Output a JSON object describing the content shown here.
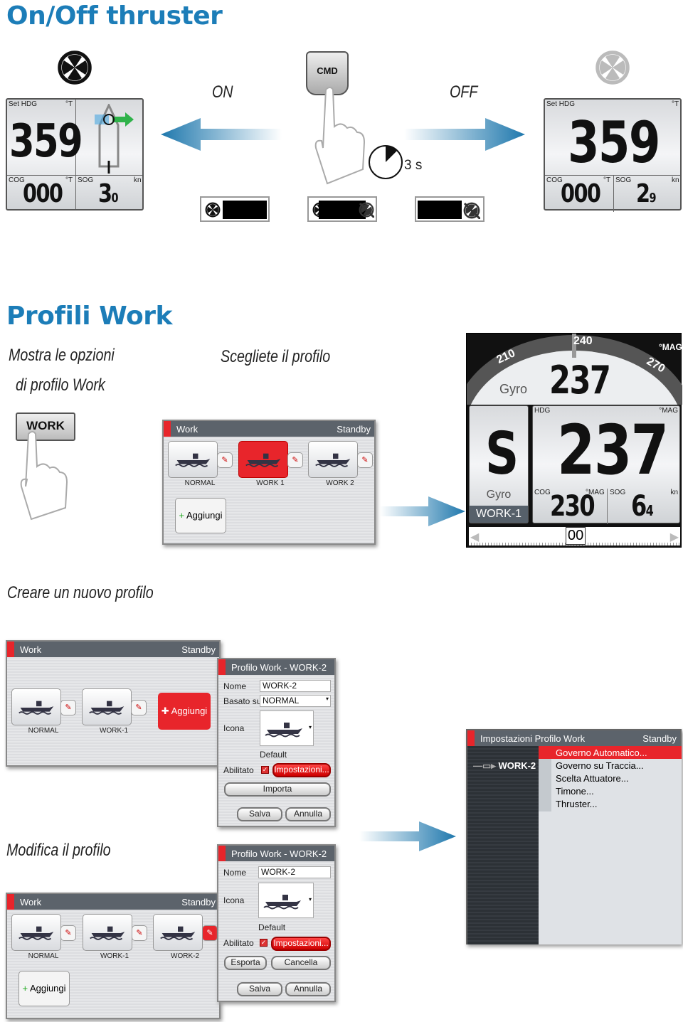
{
  "section1": {
    "title": "On/Off thruster",
    "on_label": "ON",
    "off_label": "OFF",
    "cmd_label": "CMD",
    "timer_label": "3 s",
    "left_display": {
      "set_hdg_label": "Set HDG",
      "hdg_unit": "°T",
      "hdg_value": "359",
      "cog_label": "COG",
      "cog_unit": "°T",
      "cog_value": "000",
      "sog_label": "SOG",
      "sog_unit": "kn",
      "sog_value": "3",
      "sog_decimal": "0"
    },
    "right_display": {
      "set_hdg_label": "Set HDG",
      "hdg_unit": "°T",
      "hdg_value": "359",
      "cog_label": "COG",
      "cog_unit": "°T",
      "cog_value": "000",
      "sog_label": "SOG",
      "sog_unit": "kn",
      "sog_value": "2",
      "sog_decimal": "9"
    }
  },
  "section2": {
    "title": "Profili Work",
    "caption_show_line1": "Mostra le opzioni",
    "caption_show_line2": "di profilo Work",
    "caption_choose": "Scegliete il profilo",
    "work_button": "WORK",
    "work_window": {
      "title": "Work",
      "status": "Standby",
      "tiles": [
        "NORMAL",
        "WORK 1",
        "WORK 2"
      ],
      "selected": "WORK 1",
      "add_button": "Aggiungi"
    },
    "autopilot": {
      "compass_ticks": [
        "210",
        "240",
        "270"
      ],
      "compass_unit": "°MAG",
      "source": "Gyro",
      "heading": "237",
      "mode": "S",
      "mode_source": "Gyro",
      "profile": "WORK-1",
      "hdg_label": "HDG",
      "hdg_unit": "°MAG",
      "hdg_value": "237",
      "cog_label": "COG",
      "cog_unit": "°MAG",
      "cog_value": "230",
      "sog_label": "SOG",
      "sog_unit": "kn",
      "sog_value": "6",
      "sog_decimal": "4",
      "rudder_value": "00"
    }
  },
  "section3": {
    "caption": "Creare un nuovo profilo",
    "work_window": {
      "title": "Work",
      "status": "Standby",
      "tiles": [
        "NORMAL",
        "WORK-1"
      ],
      "add_button": "Aggiungi"
    },
    "dialog": {
      "title": "Profilo Work - WORK-2",
      "name_label": "Nome",
      "name_value": "WORK-2",
      "based_label": "Basato su",
      "based_value": "NORMAL",
      "icon_label": "Icona",
      "icon_caption": "Default",
      "enabled_label": "Abilitato",
      "enabled": true,
      "settings_button": "Impostazioni...",
      "import_button": "Importa",
      "save_button": "Salva",
      "cancel_button": "Annulla"
    },
    "settings_window": {
      "title": "Impostazioni Profilo Work",
      "status": "Standby",
      "profile": "WORK-2",
      "items": [
        "Governo Automatico...",
        "Governo su Traccia...",
        "Scelta Attuatore...",
        "Timone...",
        "Thruster..."
      ],
      "selected": "Governo Automatico..."
    }
  },
  "section4": {
    "caption": "Modifica il profilo",
    "work_window": {
      "title": "Work",
      "status": "Standby",
      "tiles": [
        "NORMAL",
        "WORK-1",
        "WORK-2"
      ],
      "add_button": "Aggiungi"
    },
    "dialog": {
      "title": "Profilo Work - WORK-2",
      "name_label": "Nome",
      "name_value": "WORK-2",
      "icon_label": "Icona",
      "icon_caption": "Default",
      "enabled_label": "Abilitato",
      "enabled": true,
      "settings_button": "Impostazioni...",
      "export_button": "Esporta",
      "delete_button": "Cancella",
      "save_button": "Salva",
      "cancel_button": "Annulla"
    }
  },
  "colors": {
    "title": "#1c7db8",
    "accent": "#e8252b",
    "bar": "#5c636b",
    "arrow": "#2a86b8"
  }
}
